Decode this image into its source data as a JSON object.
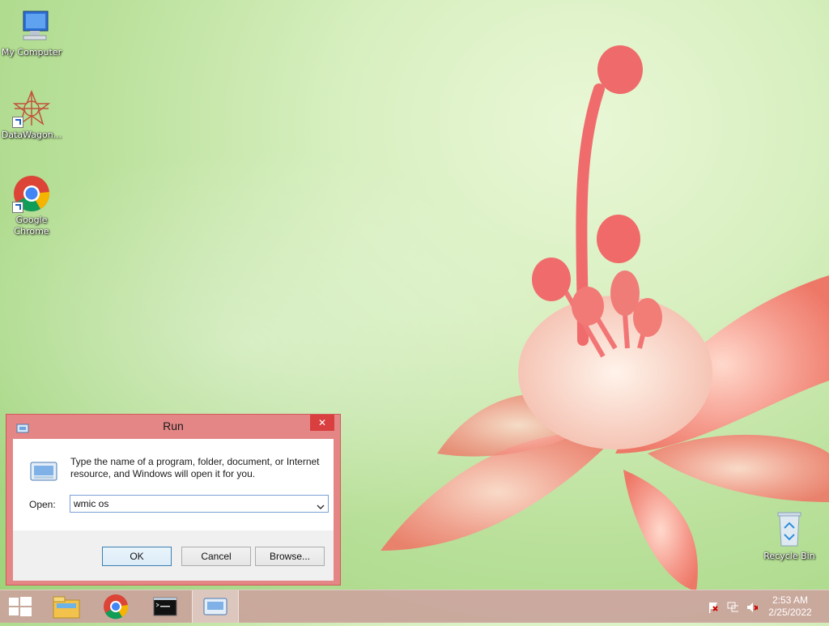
{
  "desktop": {
    "icons": [
      {
        "label": "My Computer"
      },
      {
        "label": "DataWagon..."
      },
      {
        "label": "Google Chrome"
      },
      {
        "label": "Recycle Bin"
      }
    ]
  },
  "run_dialog": {
    "title": "Run",
    "close_glyph": "✕",
    "description": "Type the name of a program, folder, document, or Internet resource, and Windows will open it for you.",
    "open_label": "Open:",
    "open_value": "wmic os",
    "ok_label": "OK",
    "cancel_label": "Cancel",
    "browse_label": "Browse..."
  },
  "taskbar": {
    "items": [
      "start-icon",
      "file-explorer-icon",
      "chrome-icon",
      "cmd-icon",
      "run-icon"
    ],
    "tray": [
      "action-center-flag-icon",
      "network-icon",
      "volume-muted-icon"
    ],
    "clock": {
      "time": "2:53 AM",
      "date": "2/25/2022"
    }
  },
  "colors": {
    "dialog_frame": "#e58686",
    "close_button": "#d93f3f",
    "taskbar": "#cfa0a0"
  }
}
